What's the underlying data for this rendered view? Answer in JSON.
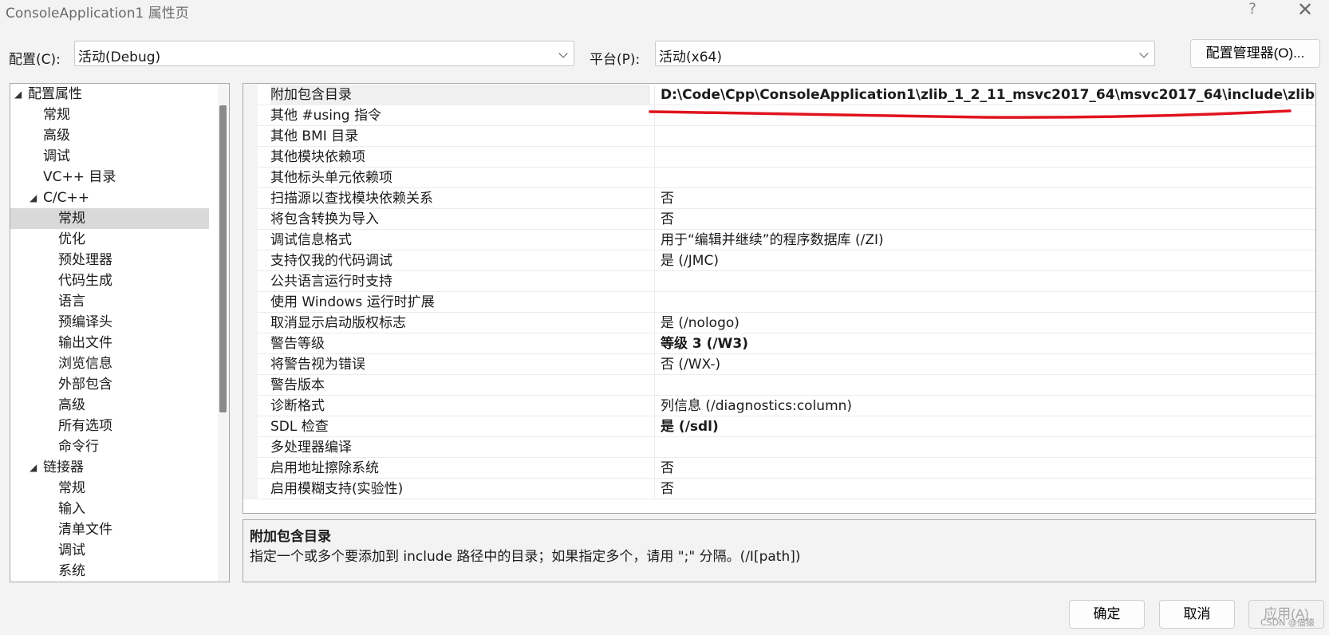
{
  "window": {
    "title": "ConsoleApplication1 属性页",
    "help_label": "?",
    "close_label": "✕"
  },
  "config": {
    "config_label": "配置(C):",
    "config_value": "活动(Debug)",
    "platform_label": "平台(P):",
    "platform_value": "活动(x64)",
    "manager_button": "配置管理器(O)..."
  },
  "tree": {
    "items": [
      {
        "label": "配置属性",
        "expander": "◢"
      },
      {
        "label": "常规"
      },
      {
        "label": "高级"
      },
      {
        "label": "调试"
      },
      {
        "label": "VC++ 目录"
      },
      {
        "label": "C/C++",
        "expander": "◢"
      },
      {
        "label": "常规"
      },
      {
        "label": "优化"
      },
      {
        "label": "预处理器"
      },
      {
        "label": "代码生成"
      },
      {
        "label": "语言"
      },
      {
        "label": "预编译头"
      },
      {
        "label": "输出文件"
      },
      {
        "label": "浏览信息"
      },
      {
        "label": "外部包含"
      },
      {
        "label": "高级"
      },
      {
        "label": "所有选项"
      },
      {
        "label": "命令行"
      },
      {
        "label": "链接器",
        "expander": "◢"
      },
      {
        "label": "常规"
      },
      {
        "label": "输入"
      },
      {
        "label": "清单文件"
      },
      {
        "label": "调试"
      },
      {
        "label": "系统"
      }
    ]
  },
  "grid": {
    "rows": [
      {
        "name": "附加包含目录",
        "value": "D:\\Code\\Cpp\\ConsoleApplication1\\zlib_1_2_11_msvc2017_64\\msvc2017_64\\include\\zlib"
      },
      {
        "name": "其他 #using 指令",
        "value": ""
      },
      {
        "name": "其他 BMI 目录",
        "value": ""
      },
      {
        "name": "其他模块依赖项",
        "value": ""
      },
      {
        "name": "其他标头单元依赖项",
        "value": ""
      },
      {
        "name": "扫描源以查找模块依赖关系",
        "value": "否"
      },
      {
        "name": "将包含转换为导入",
        "value": "否"
      },
      {
        "name": "调试信息格式",
        "value": "用于“编辑并继续”的程序数据库 (/ZI)"
      },
      {
        "name": "支持仅我的代码调试",
        "value": "是 (/JMC)"
      },
      {
        "name": "公共语言运行时支持",
        "value": ""
      },
      {
        "name": "使用 Windows 运行时扩展",
        "value": ""
      },
      {
        "name": "取消显示启动版权标志",
        "value": "是 (/nologo)"
      },
      {
        "name": "警告等级",
        "value": "等级 3 (/W3)"
      },
      {
        "name": "将警告视为错误",
        "value": "否 (/WX-)"
      },
      {
        "name": "警告版本",
        "value": ""
      },
      {
        "name": "诊断格式",
        "value": "列信息 (/diagnostics:column)"
      },
      {
        "name": "SDL 检查",
        "value": "是 (/sdl)"
      },
      {
        "name": "多处理器编译",
        "value": ""
      },
      {
        "name": "启用地址擦除系统",
        "value": "否"
      },
      {
        "name": "启用模糊支持(实验性)",
        "value": "否"
      }
    ]
  },
  "description": {
    "title": "附加包含目录",
    "text": "指定一个或多个要添加到 include 路径中的目录；如果指定多个，请用 \";\" 分隔。(/I[path])"
  },
  "buttons": {
    "ok": "确定",
    "cancel": "取消",
    "apply": "应用(A)"
  },
  "watermark": "CSDN @借猿",
  "colors": {
    "annotation_red": "#e0141e",
    "selected_row": "#d9d9d9"
  }
}
